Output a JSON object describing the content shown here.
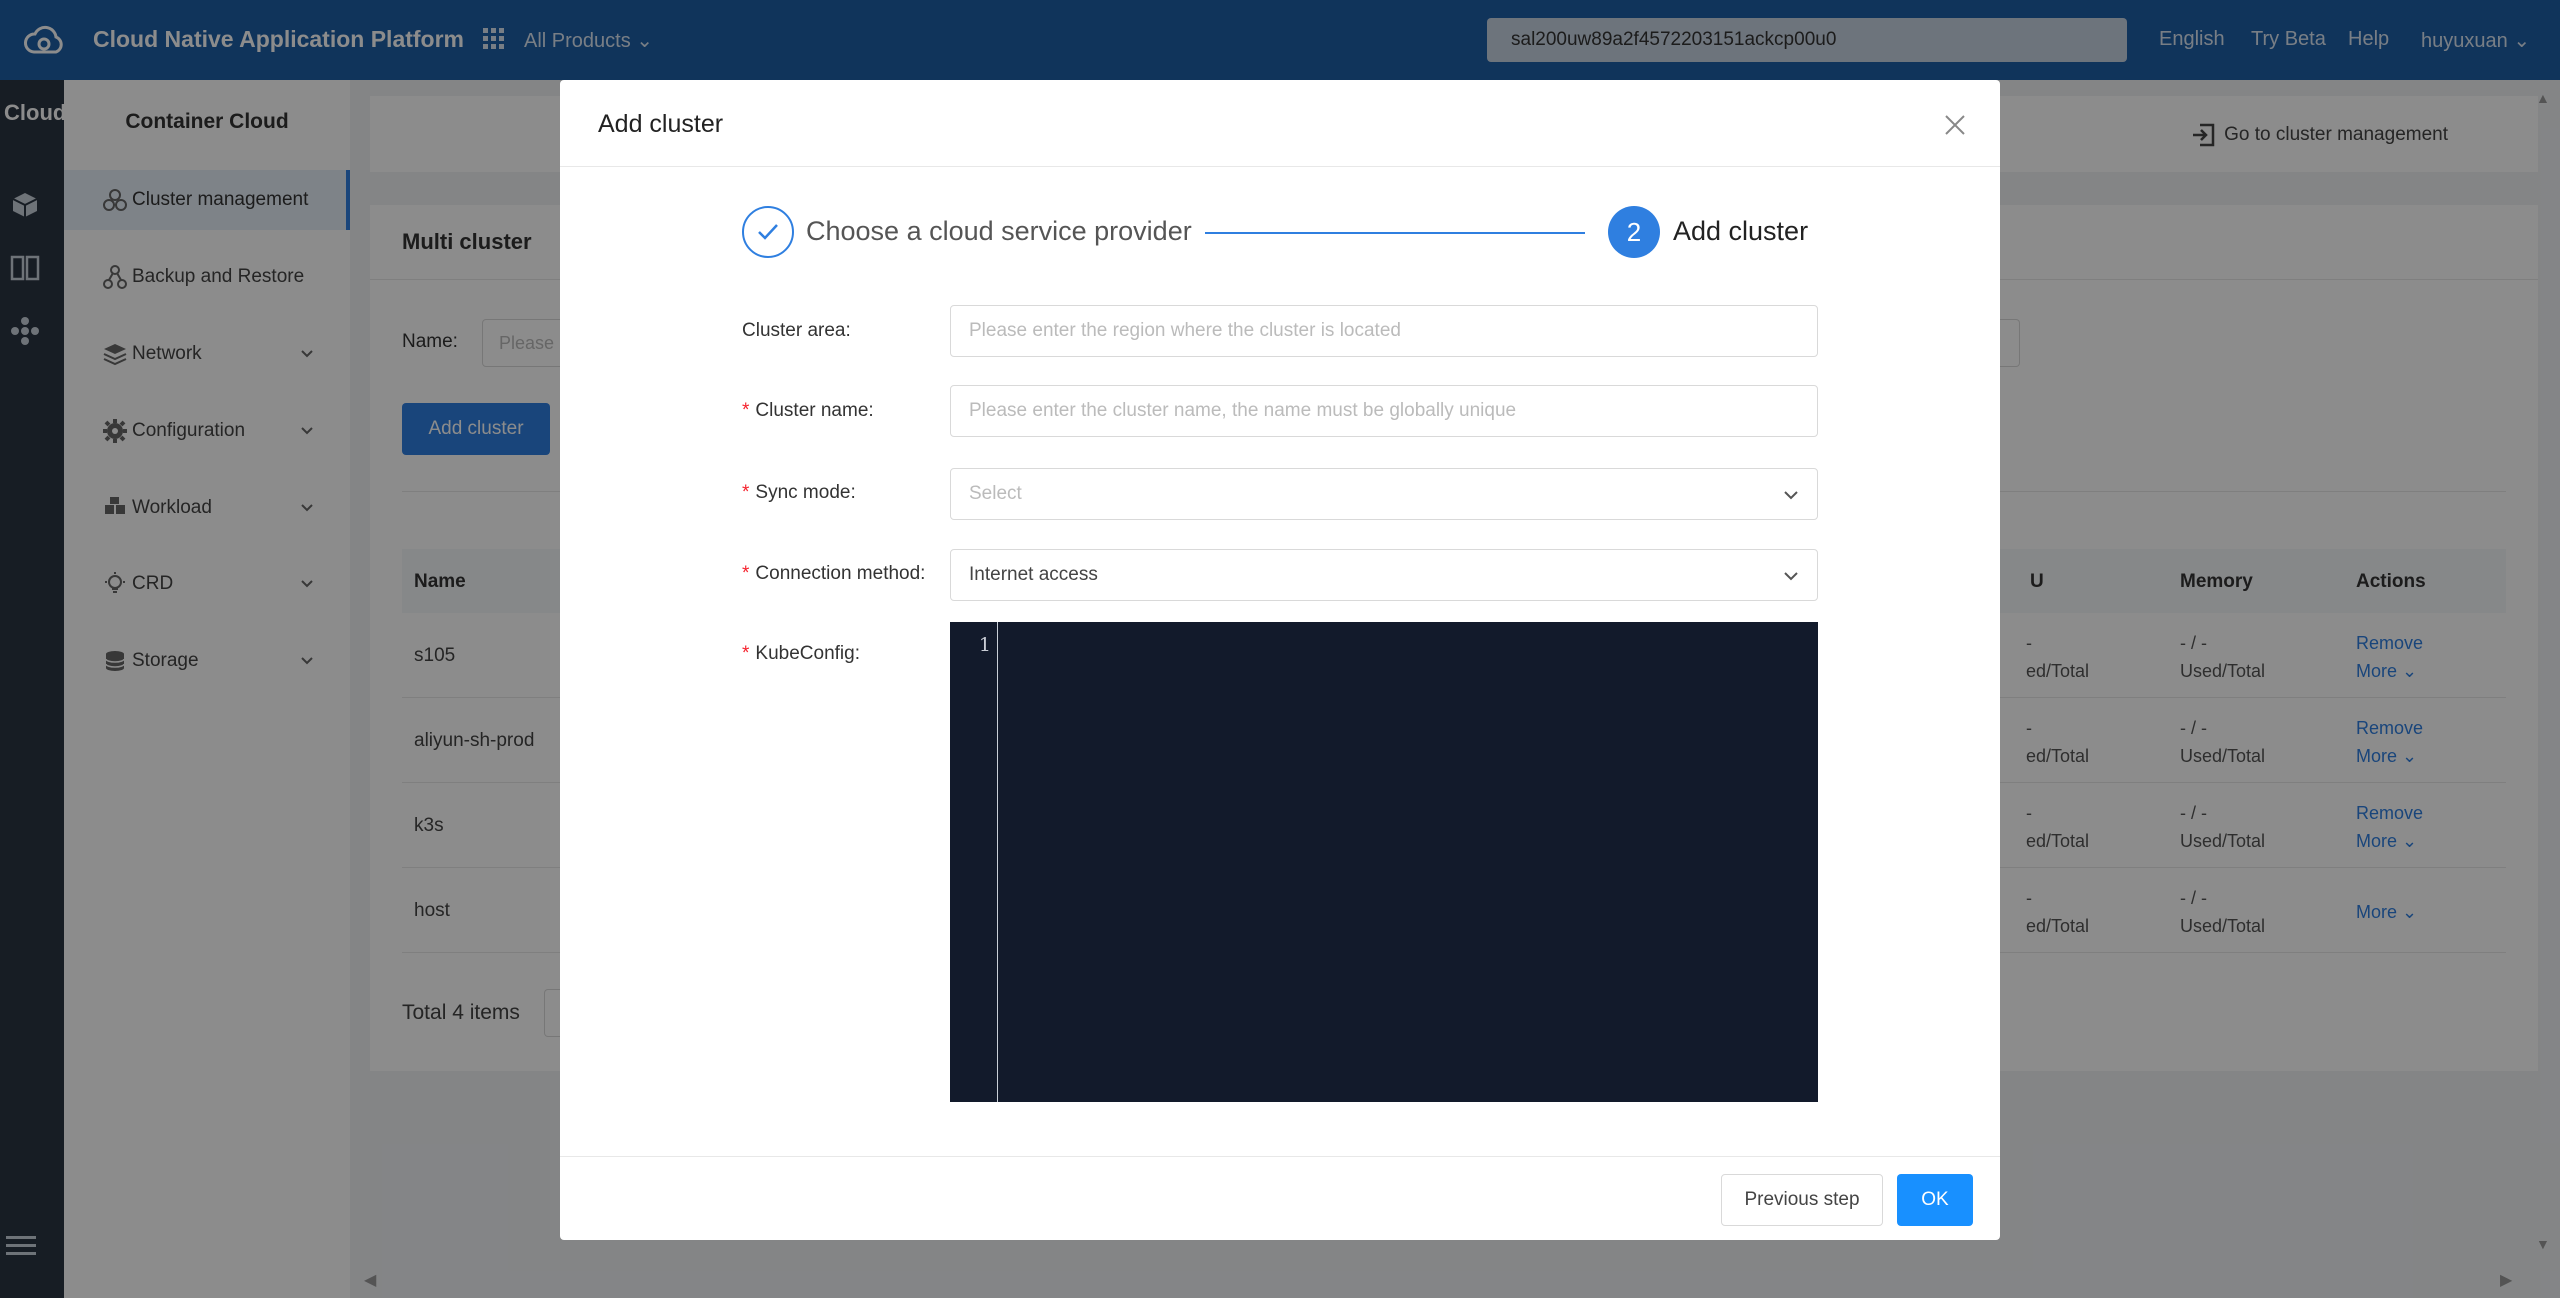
{
  "topbar": {
    "brand": "Cloud Native Application Platform",
    "products_label": "All Products",
    "search_value": "sal200uw89a2f4572203151ackcp00u0",
    "language": "English",
    "try_beta": "Try Beta",
    "help": "Help",
    "username": "huyuxuan",
    "bg_color": "#1e5fa7"
  },
  "rail": {
    "title": "Cloud",
    "icons": [
      "cube-icon",
      "columns-icon",
      "nodes-icon",
      "menu-icon"
    ]
  },
  "sidebar": {
    "title": "Container Cloud",
    "items": [
      {
        "label": "Cluster management",
        "icon": "cluster-icon",
        "active": true
      },
      {
        "label": "Backup and Restore",
        "icon": "backup-icon"
      },
      {
        "label": "Network",
        "icon": "network-icon"
      },
      {
        "label": "Configuration",
        "icon": "gear-icon"
      },
      {
        "label": "Workload",
        "icon": "workload-icon"
      },
      {
        "label": "CRD",
        "icon": "bulb-icon"
      },
      {
        "label": "Storage",
        "icon": "storage-icon"
      }
    ]
  },
  "main": {
    "goto_label": "Go to cluster management",
    "card_title": "Multi cluster",
    "name_label": "Name:",
    "name_placeholder": "Please",
    "add_button": "Add cluster",
    "columns": {
      "name": "Name",
      "cpu": "U",
      "memory": "Memory",
      "actions": "Actions"
    },
    "rows": [
      {
        "name": "s105",
        "cpu_1": "-",
        "cpu_2": "ed/Total",
        "mem_1": "- / -",
        "mem_2": "Used/Total",
        "remove": "Remove",
        "more": "More"
      },
      {
        "name": "aliyun-sh-prod",
        "cpu_1": "-",
        "cpu_2": "ed/Total",
        "mem_1": "- / -",
        "mem_2": "Used/Total",
        "remove": "Remove",
        "more": "More"
      },
      {
        "name": "k3s",
        "cpu_1": "-",
        "cpu_2": "ed/Total",
        "mem_1": "- / -",
        "mem_2": "Used/Total",
        "remove": "Remove",
        "more": "More"
      },
      {
        "name": "host",
        "cpu_1": "-",
        "cpu_2": "ed/Total",
        "mem_1": "- / -",
        "mem_2": "Used/Total",
        "remove": "",
        "more": "More"
      }
    ],
    "total": "Total 4 items"
  },
  "modal": {
    "title": "Add cluster",
    "steps": [
      {
        "label": "Choose a cloud service provider",
        "state": "done"
      },
      {
        "number": "2",
        "label": "Add cluster",
        "state": "current"
      }
    ],
    "fields": {
      "cluster_area": {
        "label": "Cluster area:",
        "placeholder": "Please enter the region where the cluster is located",
        "required": false
      },
      "cluster_name": {
        "label": "Cluster name:",
        "placeholder": "Please enter the cluster name, the name must be globally unique",
        "required": true
      },
      "sync_mode": {
        "label": "Sync mode:",
        "value": "Select",
        "required": true
      },
      "connection_method": {
        "label": "Connection method:",
        "value": "Internet access",
        "required": true
      },
      "kubeconfig": {
        "label": "KubeConfig:",
        "line_number": "1",
        "required": true
      }
    },
    "buttons": {
      "previous": "Previous step",
      "ok": "OK"
    },
    "accent_color": "#2f7fe0"
  }
}
